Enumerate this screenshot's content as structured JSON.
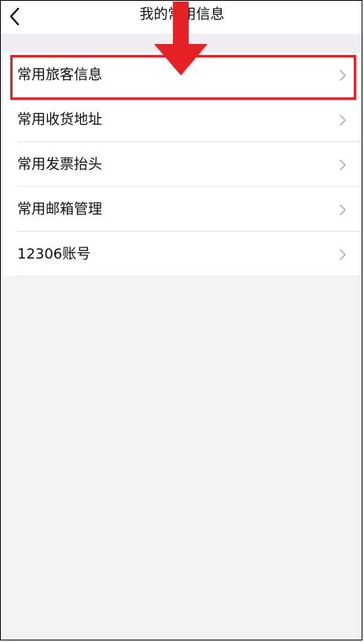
{
  "header": {
    "title": "我的常用信息"
  },
  "menu": {
    "items": [
      {
        "label": "常用旅客信息",
        "highlighted": true
      },
      {
        "label": "常用收货地址"
      },
      {
        "label": "常用发票抬头"
      },
      {
        "label": "常用邮箱管理"
      },
      {
        "label": "12306账号"
      }
    ]
  },
  "annotation": {
    "arrow_color": "#e62125",
    "box_color": "#e62125"
  },
  "colors": {
    "background": "#f4f2f5",
    "surface": "#ffffff",
    "divider": "#e4e4e4",
    "chevron": "#b3b3b3"
  }
}
